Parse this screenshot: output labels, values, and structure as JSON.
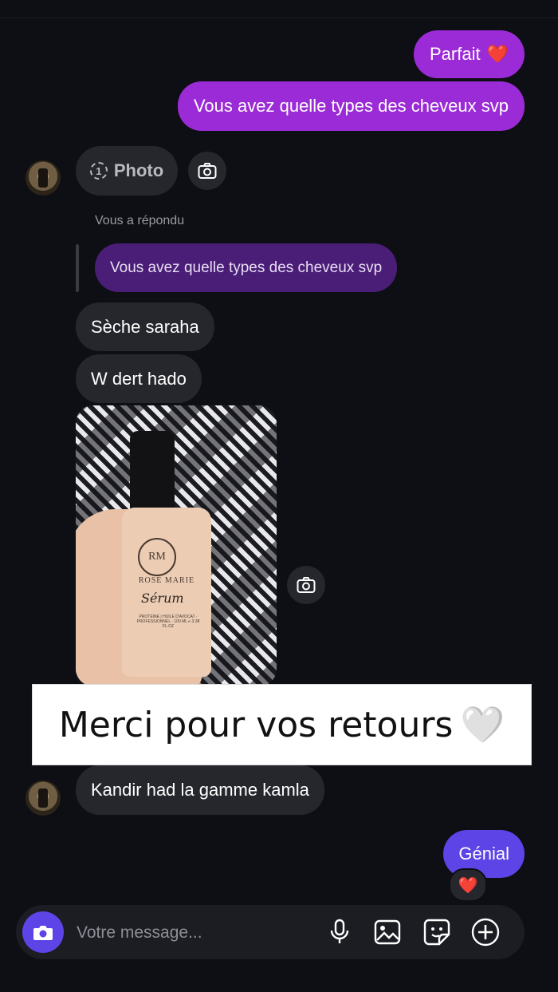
{
  "messages": {
    "parfait": "Parfait",
    "parfait_emoji": "❤️",
    "types_question": "Vous avez quelle types des cheveux svp",
    "photo_chip_label": "Photo",
    "photo_chip_count": "1",
    "reply_label": "Vous a répondu",
    "reply_quote": "Vous avez quelle types des cheveux svp",
    "seche": "Sèche saraha",
    "wdert": "W dert hado",
    "kandir": "Kandir had la gamme kamla",
    "genial": "Génial",
    "reaction": "❤️"
  },
  "photo_product": {
    "logo": "RM",
    "brand": "ROSE MARIE",
    "name": "Sérum",
    "subtitle": "PROTÉINE | HUILE D'AVOCAT · PROFESSIONNEL · 100 ML ℮ 3.38 FL.OZ"
  },
  "banner": {
    "text": "Merci pour vos retours",
    "emoji": "🤍"
  },
  "composer": {
    "placeholder": "Votre message..."
  },
  "icons": [
    "camera-icon",
    "microphone-icon",
    "gallery-icon",
    "sticker-icon",
    "plus-icon"
  ],
  "colors": {
    "background": "#0d0f14",
    "outgoing": "#9b2bd6",
    "incoming": "#26272d",
    "accent": "#5c44e6",
    "reply": "#4a1d77"
  }
}
